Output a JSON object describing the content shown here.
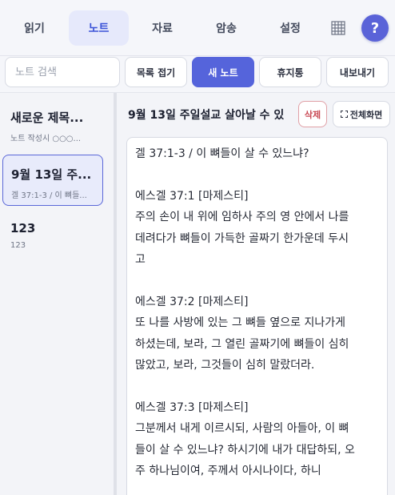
{
  "nav": {
    "tabs": [
      {
        "label": "읽기"
      },
      {
        "label": "노트"
      },
      {
        "label": "자료"
      },
      {
        "label": "암송"
      },
      {
        "label": "설정"
      }
    ],
    "active_tab": "노트",
    "grid_icon": "grid-icon",
    "help_label": "?"
  },
  "toolbar": {
    "search_placeholder": "노트 검색",
    "collapse_label": "목록 접기",
    "new_note_label": "새 노트",
    "trash_label": "휴지통",
    "export_label": "내보내기"
  },
  "sidebar": {
    "notes": [
      {
        "title": "새로운 제목...",
        "subtitle": "노트 작성시 ○○○..."
      },
      {
        "title": "9월 13일 주...",
        "subtitle": "겔 37:1-3 / 이 뼈들..."
      },
      {
        "title": "123",
        "subtitle": "123"
      }
    ],
    "active_index": 1
  },
  "main": {
    "note_title": "9월 13일 주일설교 살아날 수 있",
    "delete_label": "삭제",
    "fullscreen_label": "전체화면",
    "fullscreen_icon": "expand-icon",
    "body_lines": [
      "겔 37:1-3 / 이 뼈들이 살 수 있느냐?",
      "",
      "에스겔 37:1 [마제스티]",
      "주의 손이 내 위에 임하사 주의 영 안에서 나를",
      "데려다가 뼈들이 가득한 골짜기 한가운데 두시",
      "고",
      "",
      "에스겔 37:2 [마제스티]",
      "또 나를 사방에 있는 그 뼈들 옆으로 지나가게",
      "하셨는데, 보라, 그 열린 골짜기에 뼈들이 심히",
      "많았고, 보라, 그것들이 심히 말랐더라.",
      "",
      "에스겔 37:3 [마제스티]",
      "그분께서 내게 이르시되, 사람의 아들아, 이 뼈",
      "들이 살 수 있느냐? 하시기에 내가 대답하되, 오",
      "주 하나님이여, 주께서 아시나이다, 하니"
    ]
  },
  "colors": {
    "accent": "#5564db",
    "active_tab_bg": "#e6e9fb",
    "delete": "#c94a55"
  }
}
